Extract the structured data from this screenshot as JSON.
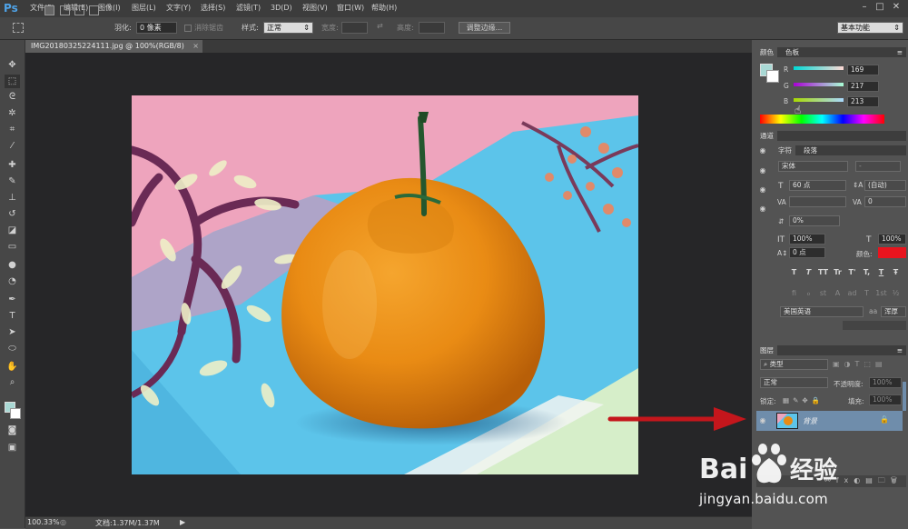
{
  "menu": {
    "logo": "Ps",
    "items": [
      "文件(F)",
      "编辑(E)",
      "图像(I)",
      "图层(L)",
      "文字(Y)",
      "选择(S)",
      "滤镜(T)",
      "3D(D)",
      "视图(V)",
      "窗口(W)",
      "帮助(H)"
    ],
    "workspace": "基本功能"
  },
  "options": {
    "feather_label": "羽化:",
    "feather_value": "0 像素",
    "antialias_label": "消除锯齿",
    "style_label": "样式:",
    "style_value": "正常",
    "width_label": "宽度:",
    "height_label": "高度:",
    "refine_edge": "调整边缘..."
  },
  "document": {
    "tab_title": "IMG20180325224111.jpg @ 100%(RGB/8)",
    "zoom": "100.33%",
    "doc_info": "文档:1.37M/1.37M"
  },
  "color_panel": {
    "tabs": [
      "颜色",
      "色板"
    ],
    "r_label": "R",
    "g_label": "G",
    "b_label": "B",
    "r": "169",
    "g": "217",
    "b": "213",
    "swatch_color": "#a9d9d5"
  },
  "channels_panel": {
    "tab": "通道"
  },
  "char_panel": {
    "tabs": [
      "字符",
      "段落"
    ],
    "font_family": "宋体",
    "font_style": "-",
    "font_size": "60 点",
    "leading": "(自动)",
    "kerning": "",
    "tracking": "0",
    "vscale_shift": "0%",
    "vscale": "100%",
    "hscale": "100%",
    "baseline": "0 点",
    "color_label": "颜色:",
    "text_color": "#e8141e",
    "format_buttons": [
      "T",
      "T",
      "TT",
      "Tr",
      "T'",
      "T,",
      "T",
      "Ŧ"
    ],
    "opentype_buttons": [
      "fi",
      "ℴ",
      "st",
      "A",
      "ad",
      "T",
      "1st",
      "½"
    ],
    "language": "美国英语",
    "aa_mode": "浑厚"
  },
  "layers_panel": {
    "tab": "图层",
    "filter_kind": "类型",
    "blend_mode": "正常",
    "opacity_label": "不透明度:",
    "opacity": "100%",
    "lock_label": "锁定:",
    "fill_label": "填充:",
    "fill": "100%",
    "layers": [
      {
        "name": "背景"
      }
    ]
  },
  "watermark": {
    "logo_text": "Bai 经验",
    "url": "jingyan.baidu.com"
  }
}
